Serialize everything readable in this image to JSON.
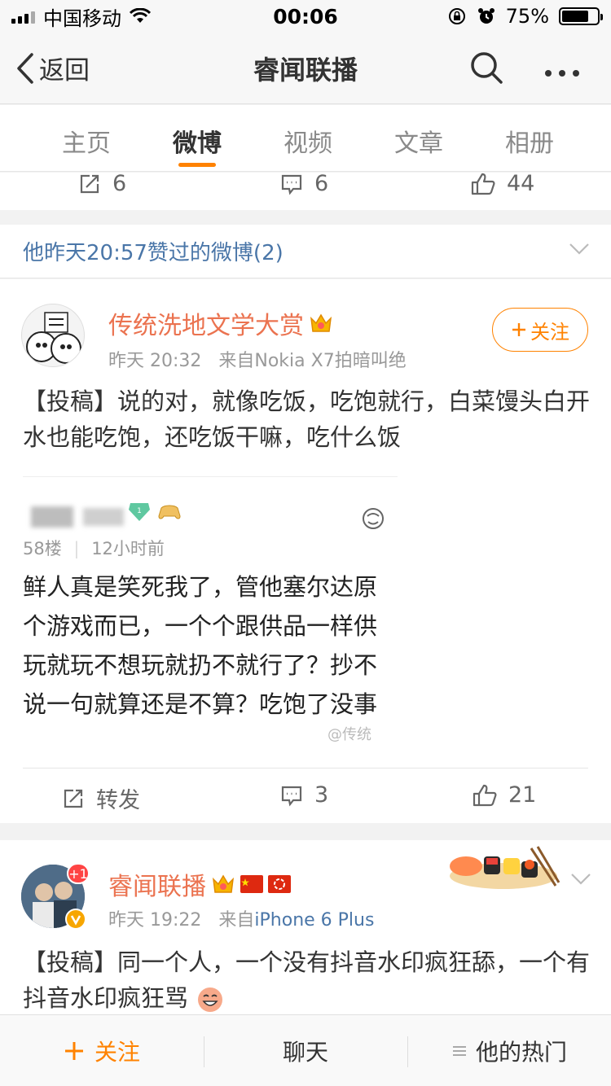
{
  "status_bar": {
    "carrier": "中国移动",
    "time": "00:06",
    "battery_percent": "75%",
    "battery_level": 0.75
  },
  "nav": {
    "back_label": "返回",
    "title": "睿闻联播"
  },
  "tabs": [
    {
      "label": "主页",
      "active": false
    },
    {
      "label": "微博",
      "active": true
    },
    {
      "label": "视频",
      "active": false
    },
    {
      "label": "文章",
      "active": false
    },
    {
      "label": "相册",
      "active": false
    }
  ],
  "prev_post_actions": {
    "repost_count": "6",
    "comment_count": "6",
    "like_count": "44"
  },
  "liked_header": {
    "text": "他昨天20:57赞过的微博(2)"
  },
  "post1": {
    "user_name": "传统洗地文学大赏",
    "time": "昨天 20:32",
    "source": "来自Nokia X7拍暗叫绝",
    "follow_label": "关注",
    "text": "【投稿】说的对，就像吃饭，吃饱就行，白菜馒头白开水也能吃饱，还吃饭干嘛，吃什么饭",
    "embed": {
      "floor": "58楼",
      "time": "12小时前",
      "lines": [
        "鲜人真是笑死我了，管他塞尔达原",
        "个游戏而已，一个个跟供品一样供",
        "玩就玩不想玩就扔不就行了？抄不",
        "说一句就算还是不算？吃饱了没事"
      ],
      "watermark": "@传统"
    },
    "actions": {
      "repost_label": "转发",
      "comment_count": "3",
      "like_count": "21"
    }
  },
  "post2": {
    "user_name": "睿闻联播",
    "badge": "+1",
    "time": "昨天 19:22",
    "source_prefix": "来自",
    "source_link": "iPhone 6 Plus",
    "text": "【投稿】同一个人，一个没有抖音水印疯狂舔，一个有抖音水印疯狂骂"
  },
  "bottom_bar": {
    "follow_label": "关注",
    "chat_label": "聊天",
    "hot_label": "他的热门"
  },
  "colors": {
    "accent": "#ff8200",
    "link": "#4a76a8",
    "username": "#eb7350"
  }
}
